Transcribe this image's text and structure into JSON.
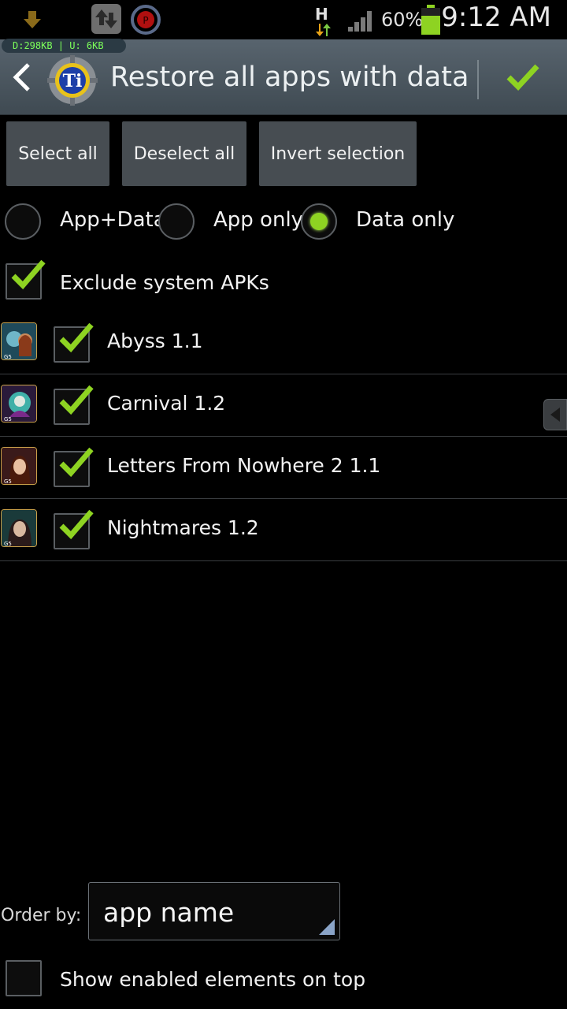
{
  "status_bar": {
    "net_traffic": "D:298KB | U: 6KB",
    "network_type": "H",
    "battery_percent": "60%",
    "time": "9:12 AM"
  },
  "action_bar": {
    "title": "Restore all apps with data",
    "confirm_icon": "check-icon",
    "back_icon": "chevron-left-icon"
  },
  "buttons": {
    "select_all": "Select all",
    "deselect_all": "Deselect all",
    "invert_selection": "Invert selection"
  },
  "restore_mode": {
    "options": [
      "App+Data",
      "App only",
      "Data only"
    ],
    "selected": "Data only"
  },
  "exclude_system_apks": {
    "label": "Exclude system APKs",
    "checked": true
  },
  "apps": [
    {
      "name": "Abyss 1.1",
      "checked": true
    },
    {
      "name": "Carnival 1.2",
      "checked": true
    },
    {
      "name": "Letters From Nowhere 2 1.1",
      "checked": true
    },
    {
      "name": "Nightmares 1.2",
      "checked": true
    }
  ],
  "order_by": {
    "label": "Order by:",
    "value": "app name"
  },
  "show_enabled_on_top": {
    "label": "Show enabled elements on top",
    "checked": false
  },
  "colors": {
    "accent_green": "#8ed322",
    "action_bar": "#4c5760",
    "button_bg": "#474d52"
  }
}
